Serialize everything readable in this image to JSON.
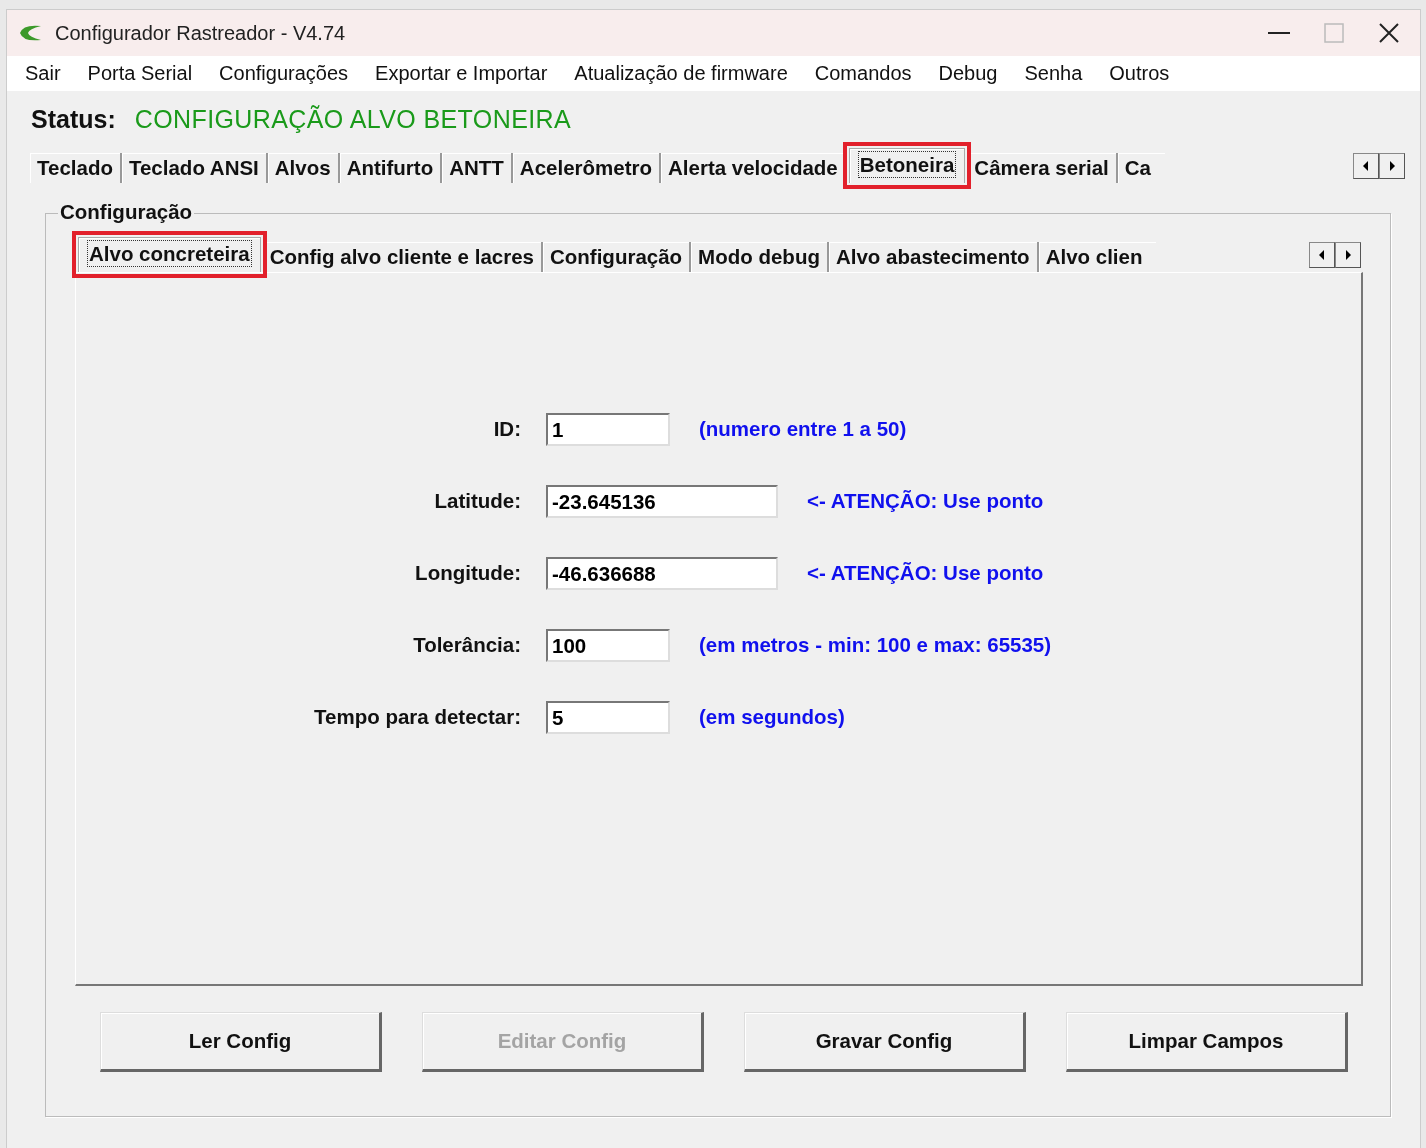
{
  "window": {
    "title": "Configurador Rastreador - V4.74"
  },
  "menu": [
    "Sair",
    "Porta Serial",
    "Configurações",
    "Exportar e Importar",
    "Atualização de firmware",
    "Comandos",
    "Debug",
    "Senha",
    "Outros"
  ],
  "status": {
    "label": "Status:",
    "value": "CONFIGURAÇÃO ALVO BETONEIRA"
  },
  "tabs": [
    {
      "label": "Teclado",
      "selected": false,
      "highlighted": false
    },
    {
      "label": "Teclado ANSI",
      "selected": false,
      "highlighted": false
    },
    {
      "label": "Alvos",
      "selected": false,
      "highlighted": false
    },
    {
      "label": "Antifurto",
      "selected": false,
      "highlighted": false
    },
    {
      "label": "ANTT",
      "selected": false,
      "highlighted": false
    },
    {
      "label": "Acelerômetro",
      "selected": false,
      "highlighted": false
    },
    {
      "label": "Alerta velocidade",
      "selected": false,
      "highlighted": false
    },
    {
      "label": "Betoneira",
      "selected": true,
      "highlighted": true
    },
    {
      "label": "Câmera serial",
      "selected": false,
      "highlighted": false
    },
    {
      "label": "Ca",
      "selected": false,
      "highlighted": false
    }
  ],
  "group": {
    "title": "Configuração"
  },
  "subtabs": [
    {
      "label": "Alvo concreteira",
      "selected": true,
      "highlighted": true
    },
    {
      "label": "Config alvo cliente e lacres",
      "selected": false,
      "highlighted": false
    },
    {
      "label": "Configuração",
      "selected": false,
      "highlighted": false
    },
    {
      "label": "Modo debug",
      "selected": false,
      "highlighted": false
    },
    {
      "label": "Alvo abastecimento",
      "selected": false,
      "highlighted": false
    },
    {
      "label": "Alvo clien",
      "selected": false,
      "highlighted": false
    }
  ],
  "fields": [
    {
      "label": "ID:",
      "value": "1",
      "kind": "short",
      "hint": "(numero entre 1 a 50)"
    },
    {
      "label": "Latitude:",
      "value": "-23.645136",
      "kind": "long",
      "hint": "<- ATENÇÃO: Use ponto"
    },
    {
      "label": "Longitude:",
      "value": "-46.636688",
      "kind": "long",
      "hint": "<- ATENÇÃO: Use ponto"
    },
    {
      "label": "Tolerância:",
      "value": "100",
      "kind": "short",
      "hint": "(em metros - min: 100 e max: 65535)"
    },
    {
      "label": "Tempo para detectar:",
      "value": "5",
      "kind": "short",
      "hint": "(em segundos)"
    }
  ],
  "buttons": [
    {
      "label": "Ler Config",
      "disabled": false
    },
    {
      "label": "Editar Config",
      "disabled": true
    },
    {
      "label": "Gravar Config",
      "disabled": false
    },
    {
      "label": "Limpar Campos",
      "disabled": false
    }
  ]
}
